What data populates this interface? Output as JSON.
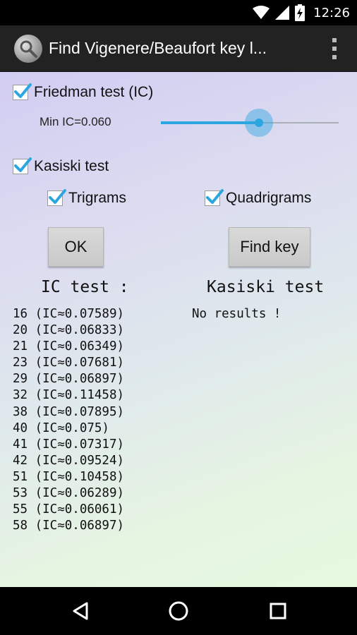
{
  "status_bar": {
    "time": "12:26",
    "icons": [
      "wifi-icon",
      "signal-icon",
      "battery-charging-icon"
    ]
  },
  "action_bar": {
    "title": "Find Vigenere/Beaufort key l...",
    "app_icon": "magnifier-icon",
    "overflow_icon": "overflow-menu-icon"
  },
  "friedman": {
    "label": "Friedman test (IC)",
    "checked": true,
    "min_ic_label": "Min IC=0.060",
    "slider_fraction": 0.55
  },
  "kasiski": {
    "label": "Kasiski test",
    "checked": true,
    "trigrams_label": "Trigrams",
    "trigrams_checked": true,
    "quadrigrams_label": "Quadrigrams",
    "quadrigrams_checked": true
  },
  "buttons": {
    "ok_label": "OK",
    "find_key_label": "Find key"
  },
  "results": {
    "ic_title": "IC test :",
    "kasiski_title": "Kasiski test",
    "ic_rows": [
      "16 (IC≈0.07589)",
      "20 (IC≈0.06833)",
      "21 (IC≈0.06349)",
      "23 (IC≈0.07681)",
      "29 (IC≈0.06897)",
      "32 (IC≈0.11458)",
      "38 (IC≈0.07895)",
      "40 (IC≈0.075)",
      "41 (IC≈0.07317)",
      "42 (IC≈0.09524)",
      "51 (IC≈0.10458)",
      "53 (IC≈0.06289)",
      "55 (IC≈0.06061)",
      "58 (IC≈0.06897)"
    ],
    "kasiski_result": "No results !"
  },
  "nav_bar": {
    "icons": [
      "back-icon",
      "home-icon",
      "recents-icon"
    ]
  },
  "colors": {
    "accent": "#2ca6e0",
    "action_bar": "#222222"
  }
}
